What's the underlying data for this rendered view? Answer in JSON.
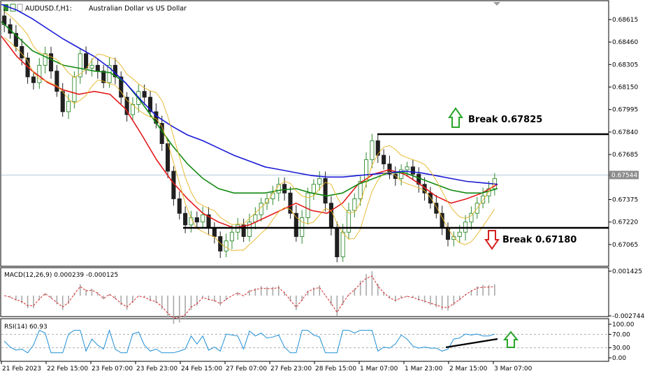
{
  "header": {
    "symbol": "AUDUSD.f,H1:",
    "description": "Australian Dollar vs US Dollar"
  },
  "colors": {
    "ema_red": "#e31a1c",
    "ema_green": "#128a12",
    "ema_blue": "#1a1ad6",
    "bollinger": "#e6b422",
    "candle_bull": "#2f8a2f",
    "candle_bear": "#202020",
    "macd_hist": "#a9a9a9",
    "macd_signal": "#d62728",
    "rsi_line": "#1f8fd6",
    "arrow_up": "#2aa52a",
    "arrow_down": "#d62020"
  },
  "price_axis": {
    "ticks": [
      "0.68615",
      "0.68460",
      "0.68305",
      "0.68150",
      "0.67995",
      "0.67840",
      "0.67685",
      "0.67544",
      "0.67375",
      "0.67220",
      "0.67065"
    ],
    "current_price": "0.67544"
  },
  "macd": {
    "label": "MACD(12,26,9) 0.000239 -0.000125",
    "ticks": [
      "0.001425",
      "-0.002744"
    ]
  },
  "rsi": {
    "label": "RSI(14) 60.93",
    "ticks": [
      "100.00",
      "70.00",
      "30.00",
      "0.00"
    ]
  },
  "time_axis": {
    "ticks": [
      "21 Feb 2023",
      "22 Feb 15:00",
      "23 Feb 07:00",
      "23 Feb 23:00",
      "24 Feb 15:00",
      "27 Feb 07:00",
      "27 Feb 23:00",
      "28 Feb 15:00",
      "1 Mar 07:00",
      "1 Mar 23:00",
      "2 Mar 15:00",
      "3 Mar 07:00"
    ]
  },
  "annotations": {
    "break_up": "Break 0.67825",
    "break_down": "Break 0.67180",
    "resistance": 0.67825,
    "support": 0.6718
  },
  "chart_data": {
    "type": "candlestick",
    "title": "AUDUSD.f,H1: Australian Dollar vs US Dollar",
    "ylim": [
      0.6692,
      0.6874
    ],
    "levels": {
      "resistance": 0.67825,
      "support": 0.6718
    },
    "series": [
      {
        "name": "Price",
        "values": [
          0.6858,
          0.6852,
          0.6843,
          0.6835,
          0.6822,
          0.6818,
          0.683,
          0.6838,
          0.6826,
          0.6812,
          0.6798,
          0.6805,
          0.6822,
          0.6838,
          0.6828,
          0.683,
          0.6826,
          0.6818,
          0.683,
          0.6822,
          0.6808,
          0.6796,
          0.6803,
          0.6812,
          0.6808,
          0.6798,
          0.679,
          0.6776,
          0.6757,
          0.6738,
          0.6728,
          0.672,
          0.6725,
          0.6722,
          0.6727,
          0.6718,
          0.6712,
          0.6702,
          0.6709,
          0.6715,
          0.672,
          0.6712,
          0.6722,
          0.6727,
          0.6735,
          0.6738,
          0.6742,
          0.6748,
          0.6742,
          0.6728,
          0.6712,
          0.6725,
          0.6742,
          0.6748,
          0.6752,
          0.6735,
          0.6718,
          0.6698,
          0.6715,
          0.673,
          0.6738,
          0.675,
          0.6765,
          0.6778,
          0.6768,
          0.6762,
          0.6755,
          0.6752,
          0.6758,
          0.676,
          0.6755,
          0.6748,
          0.6742,
          0.6735,
          0.6728,
          0.6718,
          0.671,
          0.6712,
          0.6715,
          0.6722,
          0.6728,
          0.6735,
          0.674,
          0.6745,
          0.6752
        ]
      },
      {
        "name": "EMA red",
        "values": [
          0.685,
          0.6836,
          0.6826,
          0.6818,
          0.6813,
          0.681,
          0.6812,
          0.681,
          0.68,
          0.6783,
          0.6765,
          0.675,
          0.6738,
          0.6728,
          0.6722,
          0.6718,
          0.672,
          0.6725,
          0.673,
          0.6735,
          0.673,
          0.6728,
          0.6735,
          0.6748,
          0.6755,
          0.6758,
          0.6755,
          0.6748,
          0.674,
          0.6735,
          0.6738,
          0.6742,
          0.6748
        ]
      },
      {
        "name": "EMA green",
        "values": [
          0.686,
          0.685,
          0.684,
          0.6835,
          0.683,
          0.6828,
          0.6826,
          0.6825,
          0.6818,
          0.6805,
          0.679,
          0.6775,
          0.6762,
          0.6752,
          0.6745,
          0.6742,
          0.6742,
          0.6742,
          0.6744,
          0.6745,
          0.6742,
          0.674,
          0.6742,
          0.6748,
          0.6752,
          0.6756,
          0.6756,
          0.6752,
          0.6748,
          0.6744,
          0.6742,
          0.6742,
          0.6745
        ]
      },
      {
        "name": "EMA blue",
        "values": [
          0.6872,
          0.6868,
          0.6862,
          0.6855,
          0.6848,
          0.6842,
          0.6836,
          0.6828,
          0.6818,
          0.6806,
          0.6795,
          0.6788,
          0.6782,
          0.6778,
          0.6773,
          0.6768,
          0.6764,
          0.676,
          0.6758,
          0.6756,
          0.6754,
          0.6753,
          0.6753,
          0.6754,
          0.6755,
          0.6756,
          0.6757,
          0.6756,
          0.6754,
          0.6752,
          0.675,
          0.6749,
          0.6748
        ]
      }
    ]
  }
}
